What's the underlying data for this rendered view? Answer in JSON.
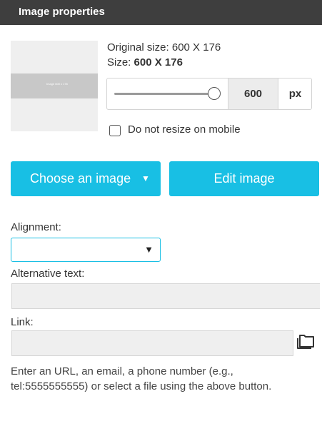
{
  "header": {
    "title": "Image properties"
  },
  "preview": {
    "thumb_text": "Image 600 x 176"
  },
  "size": {
    "original_label": "Original size: 600 X 176",
    "size_prefix": "Size: ",
    "size_value": "600 X 176",
    "width_value": "600",
    "unit": "px",
    "slider_fraction": 1.0
  },
  "mobile": {
    "checkbox_label": "Do not resize on mobile",
    "checked": false
  },
  "buttons": {
    "choose_label": "Choose an image",
    "choose_caret": "▼",
    "edit_label": "Edit image"
  },
  "alignment": {
    "label": "Alignment:",
    "value": "",
    "caret": "▼"
  },
  "alt_text": {
    "label": "Alternative text:",
    "value": ""
  },
  "link": {
    "label": "Link:",
    "value": ""
  },
  "help": {
    "text": "Enter an URL, an email, a phone number (e.g., tel:5555555555) or select a file using the above button."
  },
  "icons": {
    "folder": "folder-icon",
    "caret": "chevron-down-icon"
  },
  "colors": {
    "header_bg": "#3e3e3e",
    "accent": "#18bfe4",
    "field_bg": "#efefef"
  }
}
